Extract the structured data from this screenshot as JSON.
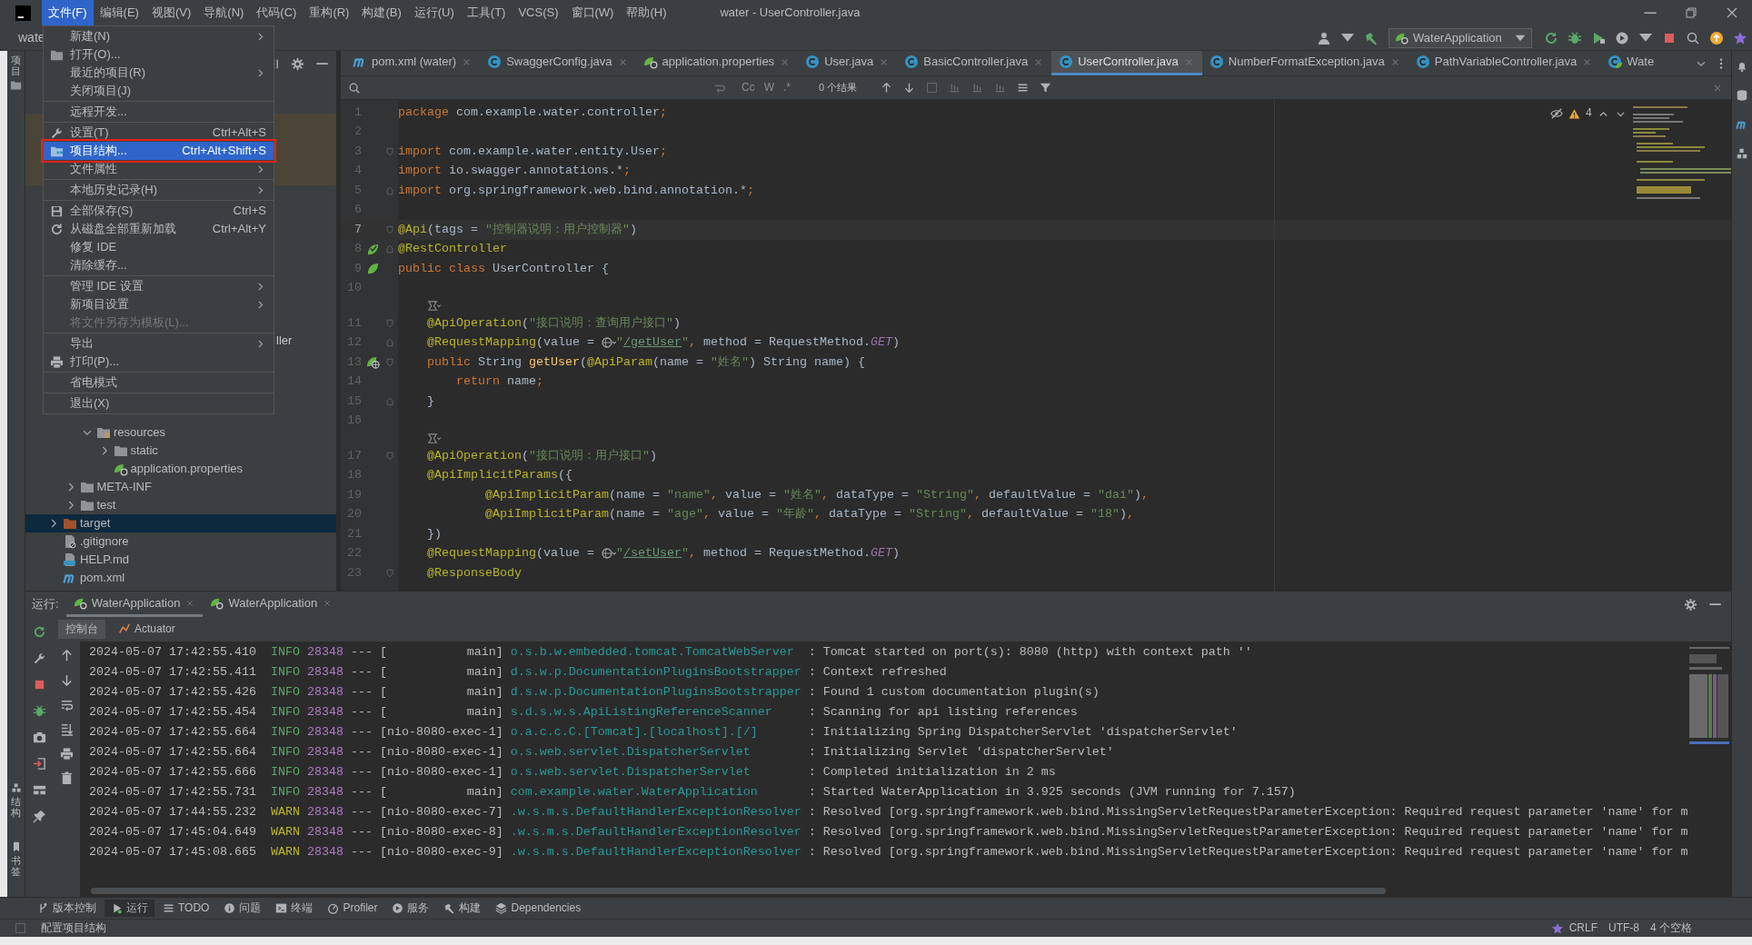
{
  "window": {
    "title": "water - UserController.java"
  },
  "menubar": [
    {
      "label": "文件(F)",
      "selected": true
    },
    {
      "label": "编辑(E)",
      "selected": false
    },
    {
      "label": "视图(V)",
      "selected": false
    },
    {
      "label": "导航(N)",
      "selected": false
    },
    {
      "label": "代码(C)",
      "selected": false
    },
    {
      "label": "重构(R)",
      "selected": false
    },
    {
      "label": "构建(B)",
      "selected": false
    },
    {
      "label": "运行(U)",
      "selected": false
    },
    {
      "label": "工具(T)",
      "selected": false
    },
    {
      "label": "VCS(S)",
      "selected": false
    },
    {
      "label": "窗口(W)",
      "selected": false
    },
    {
      "label": "帮助(H)",
      "selected": false
    }
  ],
  "toolbar": {
    "breadcrumb": "wate",
    "run_config": "WaterApplication"
  },
  "file_menu": {
    "groups": [
      [
        {
          "label": "新建(N)",
          "submenu": true,
          "selected": false,
          "disabled": false,
          "highlighted": false
        },
        {
          "label": "打开(O)...",
          "submenu": false,
          "selected": false,
          "disabled": false,
          "highlighted": false
        },
        {
          "label": "最近的项目(R)",
          "submenu": true,
          "selected": false,
          "disabled": false,
          "highlighted": false
        },
        {
          "label": "关闭项目(J)",
          "submenu": false,
          "selected": false,
          "disabled": false,
          "highlighted": false
        }
      ],
      [
        {
          "label": "远程开发...",
          "submenu": false,
          "selected": false,
          "disabled": false,
          "highlighted": false
        }
      ],
      [
        {
          "label": "设置(T)",
          "shortcut": "Ctrl+Alt+S",
          "submenu": false,
          "selected": false,
          "disabled": false,
          "highlighted": false
        },
        {
          "label": "项目结构...",
          "shortcut": "Ctrl+Alt+Shift+S",
          "submenu": false,
          "selected": true,
          "disabled": false,
          "highlighted": true
        },
        {
          "label": "文件属性",
          "submenu": true,
          "selected": false,
          "disabled": false,
          "highlighted": false
        }
      ],
      [
        {
          "label": "本地历史记录(H)",
          "submenu": true,
          "selected": false,
          "disabled": false,
          "highlighted": false
        }
      ],
      [
        {
          "label": "全部保存(S)",
          "shortcut": "Ctrl+S",
          "submenu": false,
          "selected": false,
          "disabled": false,
          "highlighted": false
        },
        {
          "label": "从磁盘全部重新加载",
          "shortcut": "Ctrl+Alt+Y",
          "submenu": false,
          "selected": false,
          "disabled": false,
          "highlighted": false
        },
        {
          "label": "修复 IDE",
          "submenu": false,
          "selected": false,
          "disabled": false,
          "highlighted": false
        },
        {
          "label": "清除缓存...",
          "submenu": false,
          "selected": false,
          "disabled": false,
          "highlighted": false
        }
      ],
      [
        {
          "label": "管理 IDE 设置",
          "submenu": true,
          "selected": false,
          "disabled": false,
          "highlighted": false
        },
        {
          "label": "新项目设置",
          "submenu": true,
          "selected": false,
          "disabled": false,
          "highlighted": false
        },
        {
          "label": "将文件另存为模板(L)...",
          "submenu": false,
          "selected": false,
          "disabled": true,
          "highlighted": false
        }
      ],
      [
        {
          "label": "导出",
          "submenu": true,
          "selected": false,
          "disabled": false,
          "highlighted": false
        },
        {
          "label": "打印(P)...",
          "submenu": false,
          "selected": false,
          "disabled": false,
          "highlighted": false
        }
      ],
      [
        {
          "label": "省电模式",
          "submenu": false,
          "selected": false,
          "disabled": false,
          "highlighted": false
        }
      ],
      [
        {
          "label": "退出(X)",
          "submenu": false,
          "selected": false,
          "disabled": false,
          "highlighted": false
        }
      ]
    ]
  },
  "left_strip": {
    "top": [
      "项目"
    ],
    "bottom": [
      "结构",
      "书签"
    ]
  },
  "project_tree": {
    "partial_label": "ller",
    "items": [
      {
        "children": [
          {
            "children": [
              {
                "label": "resources",
                "kind": "resources",
                "expanded": true,
                "selected": false,
                "children": [
                  {
                    "label": "static",
                    "kind": "folder",
                    "expanded": false,
                    "selected": false
                  },
                  {
                    "label": "application.properties",
                    "kind": "spring",
                    "selected": false
                  }
                ]
              }
            ]
          },
          {
            "label": "META-INF",
            "kind": "folder",
            "expanded": false,
            "selected": false
          },
          {
            "label": "test",
            "kind": "folder",
            "expanded": false,
            "selected": false
          }
        ]
      },
      {
        "label": "target",
        "kind": "excluded",
        "expanded": false,
        "selected": true
      },
      {
        "label": ".gitignore",
        "kind": "ignore",
        "selected": false
      },
      {
        "label": "HELP.md",
        "kind": "markdown",
        "selected": false
      },
      {
        "label": "pom.xml",
        "kind": "maven",
        "selected": false
      }
    ]
  },
  "editor_tabs": [
    {
      "label": "pom.xml (water)",
      "kind": "maven",
      "selected": false,
      "closable": true
    },
    {
      "label": "SwaggerConfig.java",
      "kind": "class",
      "selected": false,
      "closable": true
    },
    {
      "label": "application.properties",
      "kind": "spring",
      "selected": false,
      "closable": true
    },
    {
      "label": "User.java",
      "kind": "class",
      "selected": false,
      "closable": true
    },
    {
      "label": "BasicController.java",
      "kind": "class",
      "selected": false,
      "closable": true
    },
    {
      "label": "UserController.java",
      "kind": "class",
      "selected": true,
      "closable": true
    },
    {
      "label": "NumberFormatException.java",
      "kind": "class",
      "selected": false,
      "closable": true
    },
    {
      "label": "PathVariableController.java",
      "kind": "class",
      "selected": false,
      "closable": true
    },
    {
      "label": "Wate",
      "kind": "springclass",
      "selected": false,
      "closable": false
    }
  ],
  "find_bar": {
    "toggles": [
      "Cc",
      "W",
      ".*"
    ],
    "results": "0 个结果"
  },
  "inspections": {
    "warnings": "4"
  },
  "code": [
    {
      "kind": "code",
      "number": "1",
      "current": false,
      "tokens": [
        {
          "kind": "keyword",
          "text": "package"
        },
        {
          "kind": "plain",
          "text": " com.example.water.controller"
        },
        {
          "kind": "keyword",
          "text": ";"
        }
      ]
    },
    {
      "kind": "code",
      "number": "2",
      "current": false
    },
    {
      "kind": "code",
      "number": "3",
      "current": false,
      "fold": {
        "kind": "start"
      },
      "tokens": [
        {
          "kind": "keyword",
          "text": "import"
        },
        {
          "kind": "plain",
          "text": " com.example.water.entity.User"
        },
        {
          "kind": "keyword",
          "text": ";"
        }
      ]
    },
    {
      "kind": "code",
      "number": "4",
      "current": false,
      "tokens": [
        {
          "kind": "keyword",
          "text": "import"
        },
        {
          "kind": "plain",
          "text": " io.swagger.annotations.*"
        },
        {
          "kind": "keyword",
          "text": ";"
        }
      ]
    },
    {
      "kind": "code",
      "number": "5",
      "current": false,
      "fold": {
        "kind": "end"
      },
      "tokens": [
        {
          "kind": "keyword",
          "text": "import"
        },
        {
          "kind": "plain",
          "text": " org.springframework.web.bind.annotation.*"
        },
        {
          "kind": "keyword",
          "text": ";"
        }
      ]
    },
    {
      "kind": "code",
      "number": "6",
      "current": false
    },
    {
      "kind": "code",
      "number": "7",
      "current": true,
      "fold": {
        "kind": "start"
      },
      "tokens": [
        {
          "kind": "annotation",
          "text": "@Api"
        },
        {
          "kind": "plain",
          "text": "(tags = "
        },
        {
          "kind": "string",
          "text": "\"控制器说明：用户控制器\""
        },
        {
          "kind": "plain",
          "text": ")"
        }
      ]
    },
    {
      "kind": "code",
      "number": "8",
      "current": false,
      "fold": {
        "kind": "end"
      },
      "gutter": {
        "kind": "beancheck"
      },
      "tokens": [
        {
          "kind": "annotation",
          "text": "@RestController"
        }
      ]
    },
    {
      "kind": "code",
      "number": "9",
      "current": false,
      "gutter": {
        "kind": "bean"
      },
      "tokens": [
        {
          "kind": "keyword",
          "text": "public class"
        },
        {
          "kind": "plain",
          "text": " UserController {"
        }
      ]
    },
    {
      "kind": "code",
      "number": "10",
      "current": false
    },
    {
      "kind": "hint"
    },
    {
      "kind": "code",
      "number": "11",
      "current": false,
      "fold": {
        "kind": "start"
      },
      "tokens": [
        {
          "kind": "annotation",
          "text": "    @ApiOperation"
        },
        {
          "kind": "plain",
          "text": "("
        },
        {
          "kind": "string",
          "text": "\"接口说明：查询用户接口\""
        },
        {
          "kind": "plain",
          "text": ")"
        }
      ]
    },
    {
      "kind": "code",
      "number": "12",
      "current": false,
      "fold": {
        "kind": "end"
      },
      "tokens": [
        {
          "kind": "annotation",
          "text": "    @RequestMapping"
        },
        {
          "kind": "plain",
          "text": "(value = "
        },
        {
          "kind": "inlay"
        },
        {
          "kind": "string",
          "text": "\""
        },
        {
          "kind": "path",
          "text": "/getUser"
        },
        {
          "kind": "string",
          "text": "\""
        },
        {
          "kind": "keyword",
          "text": ","
        },
        {
          "kind": "plain",
          "text": " method = RequestMethod."
        },
        {
          "kind": "constant",
          "text": "GET"
        },
        {
          "kind": "plain",
          "text": ")"
        }
      ]
    },
    {
      "kind": "code",
      "number": "13",
      "current": false,
      "fold": {
        "kind": "start"
      },
      "gutter": {
        "kind": "endpoint"
      },
      "tokens": [
        {
          "kind": "keyword",
          "text": "    public"
        },
        {
          "kind": "plain",
          "text": " String "
        },
        {
          "kind": "method",
          "text": "getUser"
        },
        {
          "kind": "plain",
          "text": "("
        },
        {
          "kind": "annotation",
          "text": "@ApiParam"
        },
        {
          "kind": "plain",
          "text": "(name = "
        },
        {
          "kind": "string",
          "text": "\"姓名\""
        },
        {
          "kind": "plain",
          "text": ") String name) {"
        }
      ]
    },
    {
      "kind": "code",
      "number": "14",
      "current": false,
      "tokens": [
        {
          "kind": "keyword",
          "text": "        return"
        },
        {
          "kind": "plain",
          "text": " name"
        },
        {
          "kind": "keyword",
          "text": ";"
        }
      ]
    },
    {
      "kind": "code",
      "number": "15",
      "current": false,
      "fold": {
        "kind": "end"
      },
      "tokens": [
        {
          "kind": "plain",
          "text": "    }"
        }
      ]
    },
    {
      "kind": "code",
      "number": "16",
      "current": false
    },
    {
      "kind": "hint"
    },
    {
      "kind": "code",
      "number": "17",
      "current": false,
      "fold": {
        "kind": "start"
      },
      "tokens": [
        {
          "kind": "annotation",
          "text": "    @ApiOperation"
        },
        {
          "kind": "plain",
          "text": "("
        },
        {
          "kind": "string",
          "text": "\"接口说明：用户接口\""
        },
        {
          "kind": "plain",
          "text": ")"
        }
      ]
    },
    {
      "kind": "code",
      "number": "18",
      "current": false,
      "tokens": [
        {
          "kind": "annotation",
          "text": "    @ApiImplicitParams"
        },
        {
          "kind": "plain",
          "text": "({"
        }
      ]
    },
    {
      "kind": "code",
      "number": "19",
      "current": false,
      "tokens": [
        {
          "kind": "annotation",
          "text": "            @ApiImplicitParam"
        },
        {
          "kind": "plain",
          "text": "(name = "
        },
        {
          "kind": "string",
          "text": "\"name\""
        },
        {
          "kind": "keyword",
          "text": ","
        },
        {
          "kind": "plain",
          "text": " value = "
        },
        {
          "kind": "string",
          "text": "\"姓名\""
        },
        {
          "kind": "keyword",
          "text": ","
        },
        {
          "kind": "plain",
          "text": " dataType = "
        },
        {
          "kind": "string",
          "text": "\"String\""
        },
        {
          "kind": "keyword",
          "text": ","
        },
        {
          "kind": "plain",
          "text": " defaultValue = "
        },
        {
          "kind": "string",
          "text": "\"dai\""
        },
        {
          "kind": "plain",
          "text": ")"
        },
        {
          "kind": "keyword",
          "text": ","
        }
      ]
    },
    {
      "kind": "code",
      "number": "20",
      "current": false,
      "tokens": [
        {
          "kind": "annotation",
          "text": "            @ApiImplicitParam"
        },
        {
          "kind": "plain",
          "text": "(name = "
        },
        {
          "kind": "string",
          "text": "\"age\""
        },
        {
          "kind": "keyword",
          "text": ","
        },
        {
          "kind": "plain",
          "text": " value = "
        },
        {
          "kind": "string",
          "text": "\"年龄\""
        },
        {
          "kind": "keyword",
          "text": ","
        },
        {
          "kind": "plain",
          "text": " dataType = "
        },
        {
          "kind": "string",
          "text": "\"String\""
        },
        {
          "kind": "keyword",
          "text": ","
        },
        {
          "kind": "plain",
          "text": " defaultValue = "
        },
        {
          "kind": "string",
          "text": "\"18\""
        },
        {
          "kind": "plain",
          "text": ")"
        },
        {
          "kind": "keyword",
          "text": ","
        }
      ]
    },
    {
      "kind": "code",
      "number": "21",
      "current": false,
      "tokens": [
        {
          "kind": "plain",
          "text": "    })"
        }
      ]
    },
    {
      "kind": "code",
      "number": "22",
      "current": false,
      "tokens": [
        {
          "kind": "annotation",
          "text": "    @RequestMapping"
        },
        {
          "kind": "plain",
          "text": "(value = "
        },
        {
          "kind": "inlay"
        },
        {
          "kind": "string",
          "text": "\""
        },
        {
          "kind": "path",
          "text": "/setUser"
        },
        {
          "kind": "string",
          "text": "\""
        },
        {
          "kind": "keyword",
          "text": ","
        },
        {
          "kind": "plain",
          "text": " method = RequestMethod."
        },
        {
          "kind": "constant",
          "text": "GET"
        },
        {
          "kind": "plain",
          "text": ")"
        }
      ]
    },
    {
      "kind": "code",
      "number": "23",
      "current": false,
      "fold": {
        "kind": "start"
      },
      "tokens": [
        {
          "kind": "annotation",
          "text": "    @ResponseBody"
        }
      ]
    }
  ],
  "run_panel": {
    "label": "运行:",
    "tabs": [
      {
        "label": "WaterApplication",
        "selected": true
      },
      {
        "label": "WaterApplication",
        "selected": false
      }
    ],
    "subtabs": [
      {
        "label": "控制台",
        "selected": true
      },
      {
        "label": "Actuator",
        "selected": false
      }
    ],
    "log": [
      {
        "kind": "info",
        "time": "2024-05-07 17:42:55.410",
        "level": "INFO",
        "pid": "28348",
        "sep": "---",
        "thread": "[           main]",
        "logger": "o.s.b.w.embedded.tomcat.TomcatWebServer",
        "message": ": Tomcat started on port(s): 8080 (http) with context path ''"
      },
      {
        "kind": "info",
        "time": "2024-05-07 17:42:55.411",
        "level": "INFO",
        "pid": "28348",
        "sep": "---",
        "thread": "[           main]",
        "logger": "d.s.w.p.DocumentationPluginsBootstrapper",
        "message": ": Context refreshed"
      },
      {
        "kind": "info",
        "time": "2024-05-07 17:42:55.426",
        "level": "INFO",
        "pid": "28348",
        "sep": "---",
        "thread": "[           main]",
        "logger": "d.s.w.p.DocumentationPluginsBootstrapper",
        "message": ": Found 1 custom documentation plugin(s)"
      },
      {
        "kind": "info",
        "time": "2024-05-07 17:42:55.454",
        "level": "INFO",
        "pid": "28348",
        "sep": "---",
        "thread": "[           main]",
        "logger": "s.d.s.w.s.ApiListingReferenceScanner",
        "message": ": Scanning for api listing references"
      },
      {
        "kind": "info",
        "time": "2024-05-07 17:42:55.664",
        "level": "INFO",
        "pid": "28348",
        "sep": "---",
        "thread": "[nio-8080-exec-1]",
        "logger": "o.a.c.c.C.[Tomcat].[localhost].[/]",
        "message": ": Initializing Spring DispatcherServlet 'dispatcherServlet'"
      },
      {
        "kind": "info",
        "time": "2024-05-07 17:42:55.664",
        "level": "INFO",
        "pid": "28348",
        "sep": "---",
        "thread": "[nio-8080-exec-1]",
        "logger": "o.s.web.servlet.DispatcherServlet",
        "message": ": Initializing Servlet 'dispatcherServlet'"
      },
      {
        "kind": "info",
        "time": "2024-05-07 17:42:55.666",
        "level": "INFO",
        "pid": "28348",
        "sep": "---",
        "thread": "[nio-8080-exec-1]",
        "logger": "o.s.web.servlet.DispatcherServlet",
        "message": ": Completed initialization in 2 ms"
      },
      {
        "kind": "info",
        "time": "2024-05-07 17:42:55.731",
        "level": "INFO",
        "pid": "28348",
        "sep": "---",
        "thread": "[           main]",
        "logger": "com.example.water.WaterApplication",
        "message": ": Started WaterApplication in 3.925 seconds (JVM running for 7.157)"
      },
      {
        "kind": "warn",
        "time": "2024-05-07 17:44:55.232",
        "level": "WARN",
        "pid": "28348",
        "sep": "---",
        "thread": "[nio-8080-exec-7]",
        "logger": ".w.s.m.s.DefaultHandlerExceptionResolver",
        "message": ": Resolved [org.springframework.web.bind.MissingServletRequestParameterException: Required request parameter 'name' for m"
      },
      {
        "kind": "warn",
        "time": "2024-05-07 17:45:04.649",
        "level": "WARN",
        "pid": "28348",
        "sep": "---",
        "thread": "[nio-8080-exec-8]",
        "logger": ".w.s.m.s.DefaultHandlerExceptionResolver",
        "message": ": Resolved [org.springframework.web.bind.MissingServletRequestParameterException: Required request parameter 'name' for m"
      },
      {
        "kind": "warn",
        "time": "2024-05-07 17:45:08.665",
        "level": "WARN",
        "pid": "28348",
        "sep": "---",
        "thread": "[nio-8080-exec-9]",
        "logger": ".w.s.m.s.DefaultHandlerExceptionResolver",
        "message": ": Resolved [org.springframework.web.bind.MissingServletRequestParameterException: Required request parameter 'name' for m"
      }
    ]
  },
  "bottom_tabs": [
    {
      "label": "版本控制",
      "selected": false
    },
    {
      "label": "运行",
      "selected": true
    },
    {
      "label": "TODO",
      "selected": false
    },
    {
      "label": "问题",
      "selected": false
    },
    {
      "label": "终端",
      "selected": false
    },
    {
      "label": "Profiler",
      "selected": false
    },
    {
      "label": "服务",
      "selected": false
    },
    {
      "label": "构建",
      "selected": false
    },
    {
      "label": "Dependencies",
      "selected": false
    }
  ],
  "status_bar": {
    "message": "配置项目结构",
    "line_separator": "CRLF",
    "encoding": "UTF-8",
    "indent": "4 个空格"
  }
}
